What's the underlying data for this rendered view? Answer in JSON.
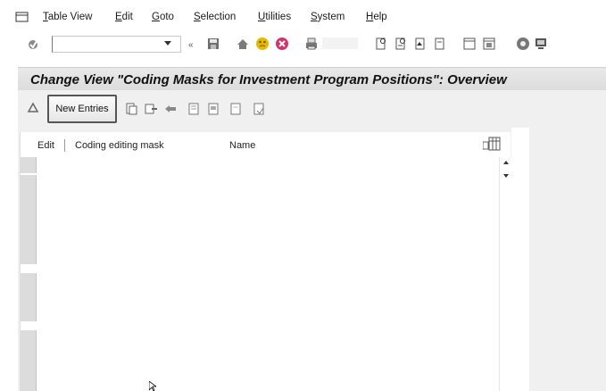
{
  "menubar": {
    "items": [
      "Table View",
      "Edit",
      "Goto",
      "Selection",
      "Utilities",
      "System",
      "Help"
    ]
  },
  "toolbar": {
    "command_field_value": "",
    "icons": [
      "enter-icon",
      "save-icon",
      "back-icon",
      "exit-icon",
      "cancel-icon",
      "print-icon",
      "find-icon",
      "find-next-icon",
      "first-page-icon",
      "previous-page-icon",
      "next-page-icon",
      "last-page-icon",
      "create-session-icon",
      "shortcut-icon",
      "help-icon",
      "layout-icon"
    ]
  },
  "title": "Change View \"Coding Masks for Investment Program Positions\": Overview",
  "app_toolbar": {
    "new_entries_label": "New Entries"
  },
  "table": {
    "columns": [
      "Edit",
      "Coding editing mask",
      "Name"
    ]
  },
  "colors": {
    "title_bg": "#e0e0e0",
    "panel_bg": "#f0f0f0",
    "exit_icon": "#e6b800",
    "cancel_icon": "#d6336c"
  }
}
